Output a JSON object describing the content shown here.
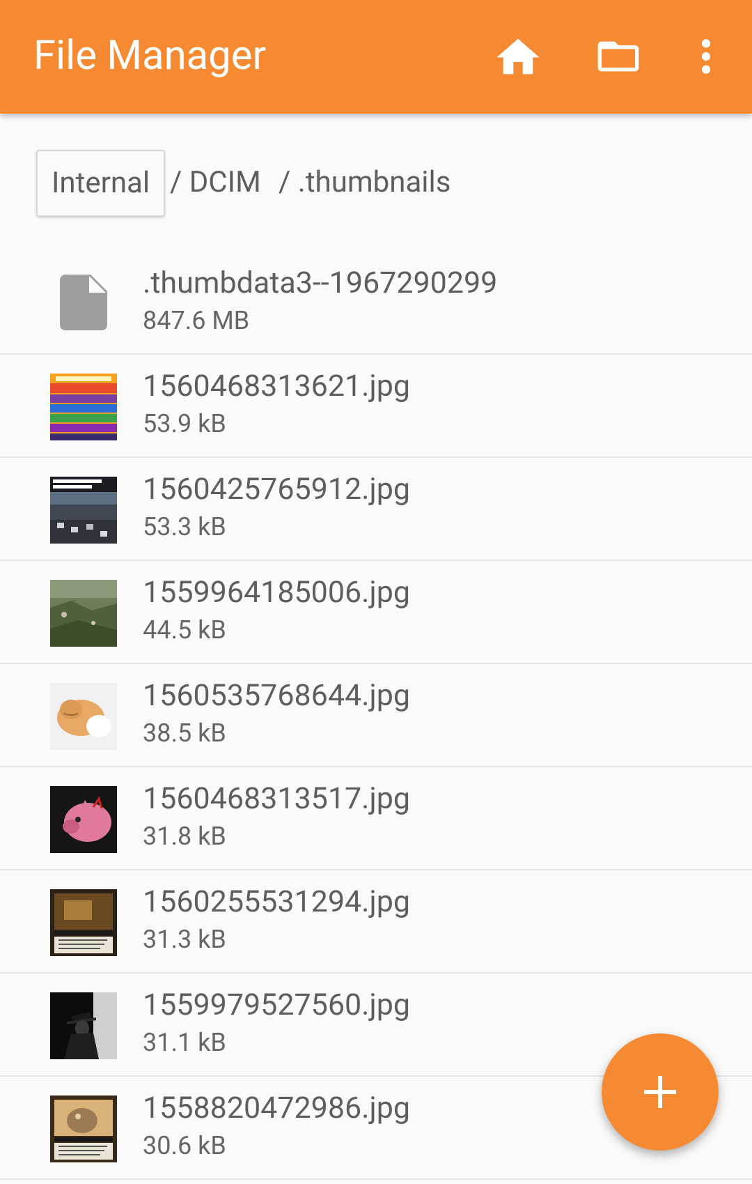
{
  "appbar": {
    "title": "File Manager",
    "color": "#f68a32",
    "actions": [
      {
        "icon": "home-icon"
      },
      {
        "icon": "folder-icon"
      },
      {
        "icon": "more-vert-icon"
      }
    ]
  },
  "breadcrumbs": {
    "internal": "Internal",
    "dcim": "/ DCIM",
    "thumbnails": "/ .thumbnails"
  },
  "files": [
    {
      "name": ".thumbdata3--1967290299",
      "size": "847.6 MB",
      "icon": "file-icon"
    },
    {
      "name": "1560468313621.jpg",
      "size": "53.9 kB",
      "icon": "image-thumbnail"
    },
    {
      "name": "1560425765912.jpg",
      "size": "53.3 kB",
      "icon": "image-thumbnail"
    },
    {
      "name": "1559964185006.jpg",
      "size": "44.5 kB",
      "icon": "image-thumbnail"
    },
    {
      "name": "1560535768644.jpg",
      "size": "38.5 kB",
      "icon": "image-thumbnail"
    },
    {
      "name": "1560468313517.jpg",
      "size": "31.8 kB",
      "icon": "image-thumbnail"
    },
    {
      "name": "1560255531294.jpg",
      "size": "31.3 kB",
      "icon": "image-thumbnail"
    },
    {
      "name": "1559979527560.jpg",
      "size": "31.1 kB",
      "icon": "image-thumbnail"
    },
    {
      "name": "1558820472986.jpg",
      "size": "30.6 kB",
      "icon": "image-thumbnail"
    }
  ],
  "fab": {
    "icon": "plus-icon"
  }
}
